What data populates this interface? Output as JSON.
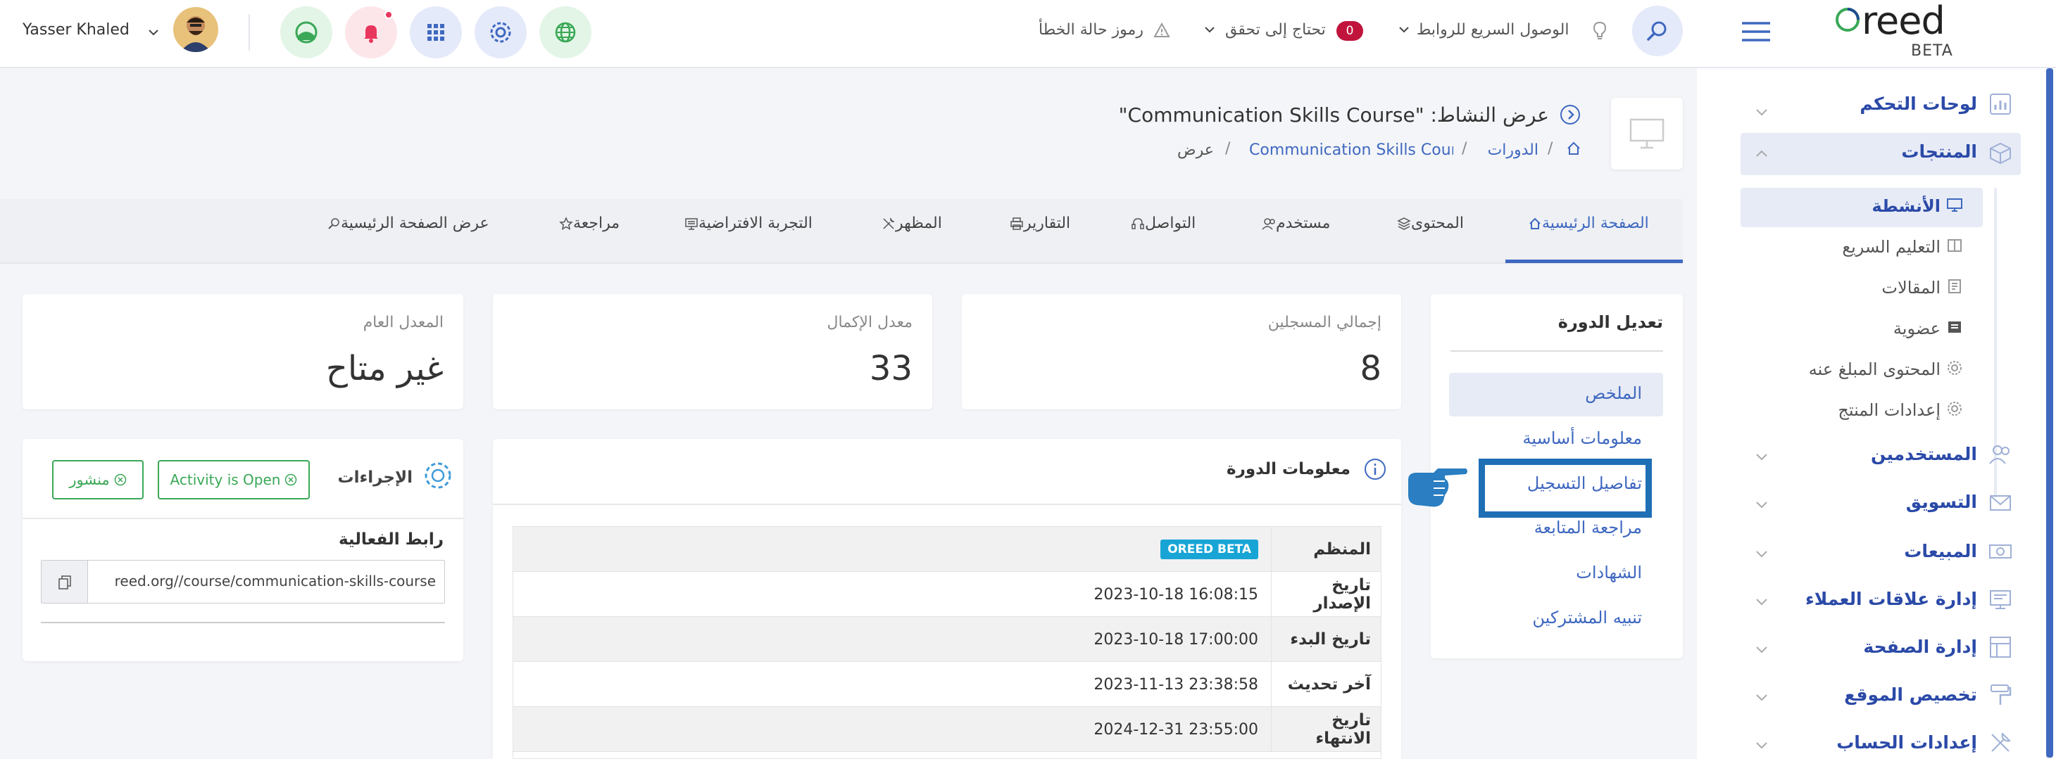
{
  "header": {
    "user_name": "Yasser Khaled",
    "error_codes": "رموز حالة الخطأ",
    "needs_check": "تحتاج إلى تحقق",
    "needs_check_count": "0",
    "quick_access": "الوصول السريع للروابط",
    "logo_text": "reed",
    "logo_beta": "BETA"
  },
  "sidebar": {
    "dashboards": "لوحات التحكم",
    "products": "المنتجات",
    "sub": [
      "الأنشطة",
      "التعليم السريع",
      "المقالات",
      "عضوية",
      "المحتوى المبلغ عنه",
      "إعدادات المنتج"
    ],
    "users": "المستخدمين",
    "marketing": "التسويق",
    "sales": "المبيعات",
    "crm": "إدارة علاقات العملاء",
    "page_mgmt": "إدارة الصفحة",
    "site_custom": "تخصيص الموقع",
    "account_settings": "إعدادات الحساب"
  },
  "page": {
    "title": "عرض النشاط: \"Communication Skills Course\"",
    "breadcrumb": [
      "الدورات",
      "Communication Skills Cour...",
      "عرض"
    ]
  },
  "tabs": [
    "الصفحة الرئيسية",
    "المحتوى",
    "مستخدم",
    "التواصل",
    "التقارير",
    "المظهر",
    "التجربة الافتراضية",
    "مراجعة",
    "عرض الصفحة الرئيسية"
  ],
  "stats": [
    {
      "label": "إجمالي المسجلين",
      "value": "8"
    },
    {
      "label": "معدل الإكمال",
      "value": "33"
    },
    {
      "label": "المعدل العام",
      "value": "غير متاح"
    }
  ],
  "course_nav": {
    "title": "تعديل الدورة",
    "items": [
      "الملخص",
      "معلومات أساسية",
      "تفاصيل التسجيل",
      "مراجعة المتابعة",
      "الشهادات",
      "تنبيه المشتركين"
    ]
  },
  "course_info": {
    "title": "معلومات الدورة",
    "rows": [
      {
        "label": "المنظم",
        "value": "OREED BETA"
      },
      {
        "label": "تاريخ الإصدار",
        "value": "2023-10-18 16:08:15"
      },
      {
        "label": "تاريخ البدء",
        "value": "2023-10-18 17:00:00"
      },
      {
        "label": "آخر تحديث",
        "value": "2023-11-13 23:38:58"
      },
      {
        "label": "تاريخ الانتهاء",
        "value": "2024-12-31 23:55:00"
      }
    ]
  },
  "actions": {
    "title": "الإجراءات",
    "published": "منشور",
    "activity_open": "Activity is Open",
    "link_label": "رابط الفعالية",
    "link_value": "reed.org//course/communication-skills-course"
  },
  "colors": {
    "accent": "#3f68c0",
    "highlight_box": "#1f6fb5",
    "pointer": "#2a7ec1",
    "badge": "#18a5d6",
    "success": "#3aa857",
    "notification": "#e8365d"
  }
}
